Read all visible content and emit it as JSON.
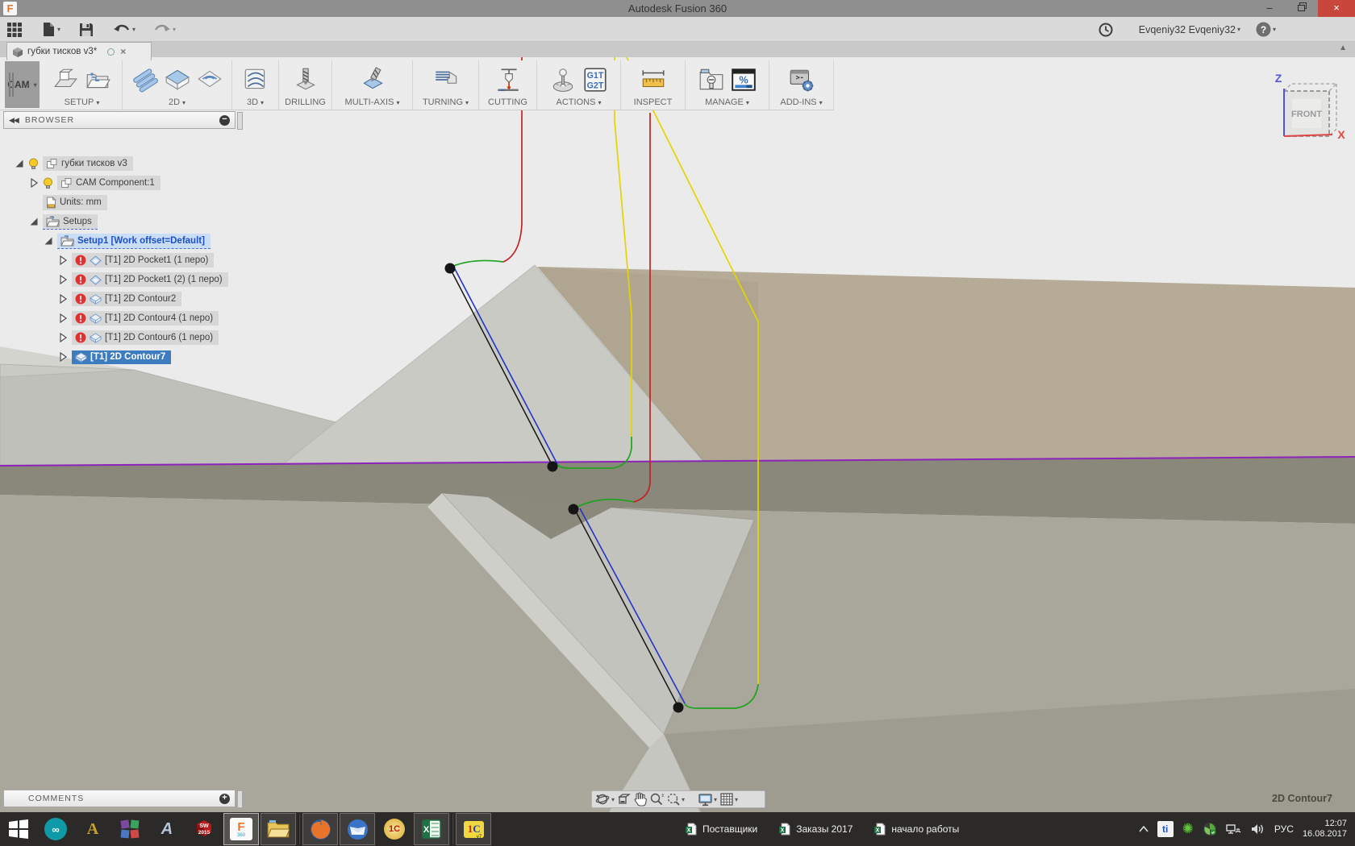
{
  "window": {
    "title": "Autodesk Fusion 360",
    "logo_letter": "F"
  },
  "account": {
    "user": "Evqeniy32 Evqeniy32"
  },
  "tab": {
    "title": "губки тисков v3*"
  },
  "ribbon": {
    "cam_label": "CAM",
    "gcode_lines": [
      "G1",
      "G2"
    ],
    "groups": [
      {
        "label": "SETUP",
        "dropdown": true,
        "icons": [
          "setup-icon",
          "setup-folder-icon"
        ]
      },
      {
        "label": "2D",
        "dropdown": true,
        "icons": [
          "pocket2d-icon",
          "face2d-icon",
          "contour2d-icon"
        ]
      },
      {
        "label": "3D",
        "dropdown": true,
        "icons": [
          "adaptive3d-icon"
        ]
      },
      {
        "label": "DRILLING",
        "dropdown": false,
        "icons": [
          "drill-icon"
        ]
      },
      {
        "label": "MULTI-AXIS",
        "dropdown": true,
        "icons": [
          "multiaxis-icon"
        ]
      },
      {
        "label": "TURNING",
        "dropdown": true,
        "icons": [
          "turning-icon"
        ]
      },
      {
        "label": "CUTTING",
        "dropdown": false,
        "icons": [
          "cutting-icon"
        ]
      },
      {
        "label": "ACTIONS",
        "dropdown": true,
        "icons": [
          "post-process-icon",
          "gcode-icon"
        ]
      },
      {
        "label": "INSPECT",
        "dropdown": false,
        "icons": [
          "measure-icon"
        ]
      },
      {
        "label": "MANAGE",
        "dropdown": true,
        "icons": [
          "manage-icon",
          "simulate-percent-icon"
        ]
      },
      {
        "label": "ADD-INS",
        "dropdown": true,
        "icons": [
          "addins-icon"
        ]
      }
    ]
  },
  "browser": {
    "header": "BROWSER",
    "rows": [
      {
        "level": 0,
        "arrow": "expanded",
        "bulb": true,
        "warn": false,
        "icon": "component",
        "label": "губки тисков v3",
        "style": "plain"
      },
      {
        "level": 1,
        "arrow": "collapsed",
        "bulb": true,
        "warn": false,
        "icon": "component",
        "label": "CAM Component:1",
        "style": "plain"
      },
      {
        "level": 1,
        "arrow": "none",
        "bulb": false,
        "warn": false,
        "icon": "units",
        "label": "Units: mm",
        "style": "plain"
      },
      {
        "level": 1,
        "arrow": "expanded",
        "bulb": false,
        "warn": false,
        "icon": "folder",
        "label": "Setups",
        "style": "dashed"
      },
      {
        "level": 2,
        "arrow": "expanded",
        "bulb": false,
        "warn": false,
        "icon": "folder",
        "label": "Setup1 [Work offset=Default]",
        "style": "setup-selected"
      },
      {
        "level": 3,
        "arrow": "collapsed",
        "bulb": false,
        "warn": true,
        "icon": "pocket",
        "label": "[T1] 2D Pocket1 (1 перо)",
        "style": "plain"
      },
      {
        "level": 3,
        "arrow": "collapsed",
        "bulb": false,
        "warn": true,
        "icon": "pocket",
        "label": "[T1] 2D Pocket1 (2) (1 перо)",
        "style": "plain"
      },
      {
        "level": 3,
        "arrow": "collapsed",
        "bulb": false,
        "warn": true,
        "icon": "contour",
        "label": "[T1] 2D Contour2",
        "style": "plain"
      },
      {
        "level": 3,
        "arrow": "collapsed",
        "bulb": false,
        "warn": true,
        "icon": "contour",
        "label": "[T1] 2D Contour4 (1 перо)",
        "style": "plain"
      },
      {
        "level": 3,
        "arrow": "collapsed",
        "bulb": false,
        "warn": true,
        "icon": "contour",
        "label": "[T1] 2D Contour6 (1 перо)",
        "style": "plain"
      },
      {
        "level": 3,
        "arrow": "collapsed",
        "bulb": false,
        "warn": false,
        "icon": "contour",
        "label": "[T1] 2D Contour7",
        "style": "selected"
      }
    ]
  },
  "comments": {
    "header": "COMMENTS"
  },
  "viewcube": {
    "front": "FRONT",
    "z_label": "Z",
    "x_label": "X"
  },
  "statusbar": {
    "operation": "2D Contour7"
  },
  "taskbar": {
    "apps": [
      {
        "icon": "windows-start-icon",
        "state": "plain"
      },
      {
        "icon": "arduino-icon",
        "state": "plain"
      },
      {
        "icon": "artcam-icon",
        "state": "plain"
      },
      {
        "icon": "cad-grid-icon",
        "state": "plain"
      },
      {
        "icon": "autocad-icon",
        "state": "plain"
      },
      {
        "icon": "solidworks-icon",
        "state": "plain"
      },
      {
        "icon": "fusion360-icon",
        "state": "active"
      },
      {
        "icon": "file-explorer-icon",
        "state": "open"
      },
      {
        "icon": "separator",
        "state": "sep"
      },
      {
        "icon": "firefox-icon",
        "state": "open"
      },
      {
        "icon": "thunderbird-icon",
        "state": "open"
      },
      {
        "icon": "onec-icon",
        "state": "plain"
      },
      {
        "icon": "excel-icon",
        "state": "open"
      },
      {
        "icon": "separator",
        "state": "sep"
      },
      {
        "icon": "onec7-icon",
        "state": "open"
      }
    ],
    "docs": [
      {
        "label": "Поставщики"
      },
      {
        "label": "Заказы 2017"
      },
      {
        "label": "начало работы"
      }
    ],
    "lang": "РУС",
    "time": "12:07",
    "date": "16.08.2017"
  },
  "colors": {
    "rapid_move": "#e3d500",
    "lead_move": "#1ea31e",
    "cutting_move": "#2433cc",
    "plunge_move": "#c42222",
    "selected_contour": "#8e23bb",
    "highlight_blue": "#3e7cc0",
    "warning_red": "#e23131",
    "tan_stock": "#b5ab97"
  }
}
